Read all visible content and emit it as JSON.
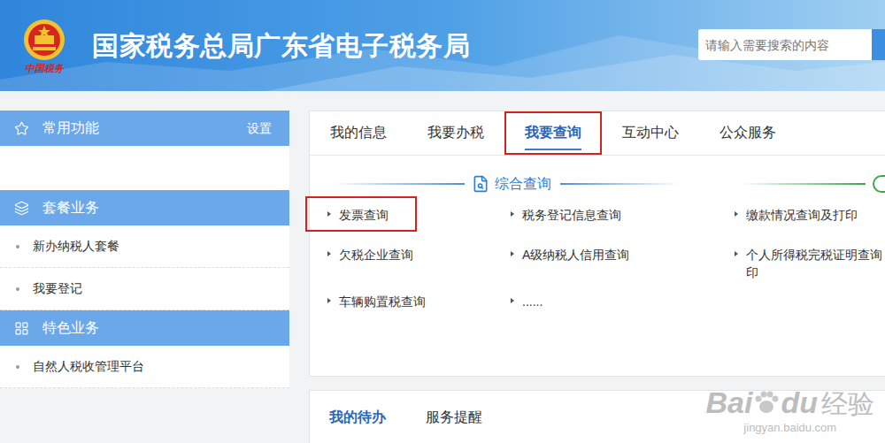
{
  "header": {
    "logo_caption": "中国税务",
    "title": "国家税务总局广东省电子税务局",
    "search": {
      "placeholder": "请输入需要搜索的内容"
    }
  },
  "sidebar": {
    "sections": [
      {
        "title": "常用功能",
        "action": "设置",
        "items": []
      },
      {
        "title": "套餐业务",
        "action": "",
        "items": [
          "新办纳税人套餐",
          "我要登记"
        ]
      },
      {
        "title": "特色业务",
        "action": "",
        "items": [
          "自然人税收管理平台"
        ]
      }
    ]
  },
  "tabs": [
    {
      "label": "我的信息",
      "selected": false
    },
    {
      "label": "我要办税",
      "selected": false
    },
    {
      "label": "我要查询",
      "selected": true
    },
    {
      "label": "互动中心",
      "selected": false
    },
    {
      "label": "公众服务",
      "selected": false
    }
  ],
  "section": {
    "title": "综合查询",
    "items": [
      {
        "lines": [
          "发票查询"
        ],
        "highlighted": true
      },
      {
        "lines": [
          "税务登记信息查询"
        ],
        "highlighted": false
      },
      {
        "lines": [
          "缴款情况查询及打印"
        ],
        "highlighted": false
      },
      {
        "lines": [
          "欠税企业查询"
        ],
        "highlighted": false
      },
      {
        "lines": [
          "A级纳税人信用查询"
        ],
        "highlighted": false
      },
      {
        "lines": [
          "个人所得税完税证明查询",
          "印"
        ],
        "highlighted": false
      },
      {
        "lines": [
          "车辆购置税查询"
        ],
        "highlighted": false
      },
      {
        "lines": [
          "......"
        ],
        "highlighted": false
      }
    ]
  },
  "bottom_tabs": [
    {
      "label": "我的待办",
      "selected": true
    },
    {
      "label": "服务提醒",
      "selected": false
    }
  ],
  "watermark": {
    "brand_left": "Bai",
    "brand_right": "du",
    "label": "经验",
    "url": "jingyan.baidu.com"
  }
}
